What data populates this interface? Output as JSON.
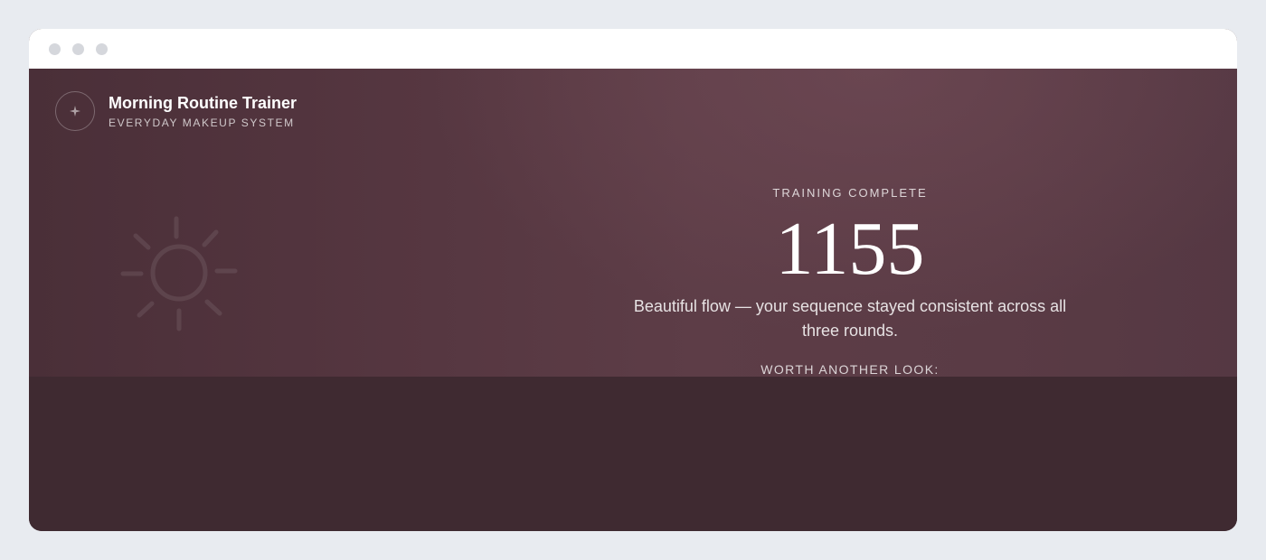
{
  "app": {
    "title": "Morning Routine Trainer",
    "subtitle": "EVERYDAY MAKEUP SYSTEM",
    "logo_icon": "sparkle-icon"
  },
  "window": {
    "controls": [
      "close-dot",
      "minimize-dot",
      "maximize-dot"
    ]
  },
  "hero": {
    "decor_icon": "sun-icon"
  },
  "result": {
    "eyebrow": "TRAINING COMPLETE",
    "score": "1155",
    "message": "Beautiful flow — your sequence stayed consistent across all three rounds.",
    "review_label": "WORTH ANOTHER LOOK:"
  },
  "colors": {
    "page_bg": "#e8ebf0",
    "chrome_bg": "#ffffff",
    "stage_bg": "#3f2a31",
    "hero_accent": "#5d3d47"
  }
}
